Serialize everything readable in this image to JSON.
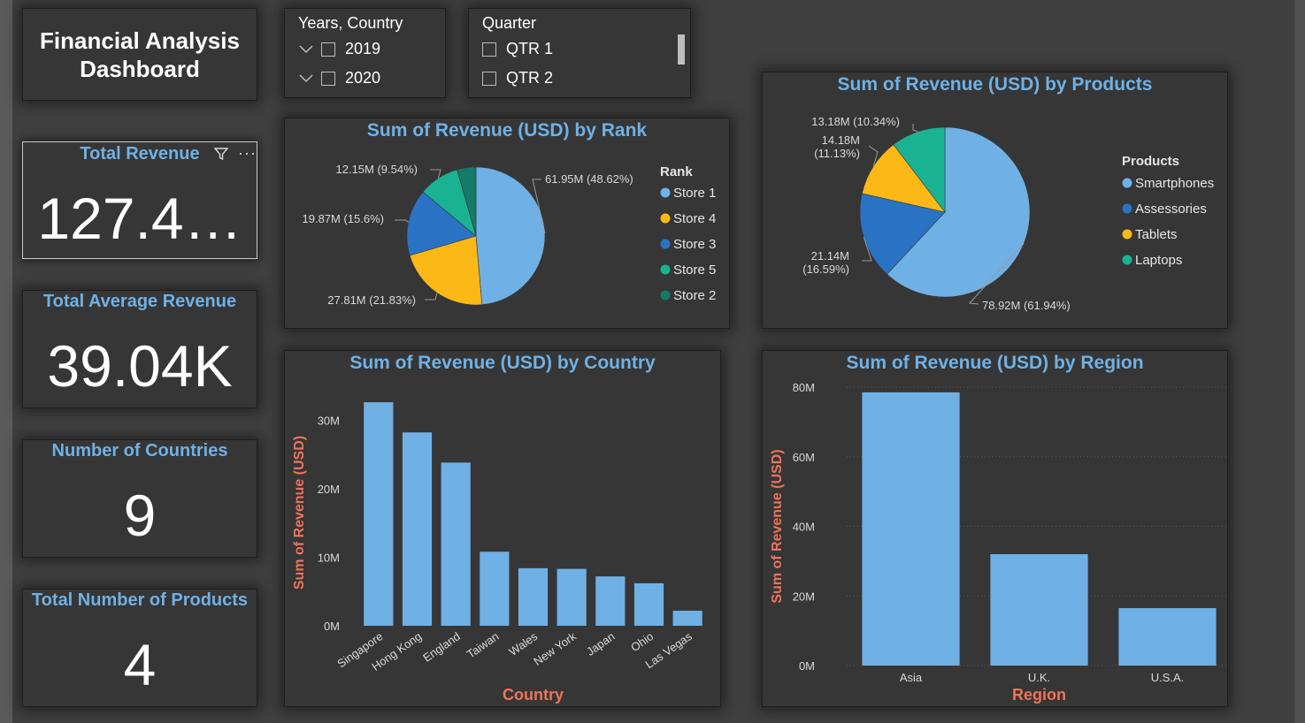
{
  "dashboard": {
    "title": "Financial Analysis Dashboard"
  },
  "colors": {
    "accent": "#6fb1e5",
    "axis_title": "#f0735a",
    "background": "#3f3f3f",
    "panel": "#363636"
  },
  "slicers": {
    "years": {
      "title": "Years, Country",
      "items": [
        {
          "label": "2019"
        },
        {
          "label": "2020"
        }
      ]
    },
    "quarter": {
      "title": "Quarter",
      "items": [
        {
          "label": "QTR 1"
        },
        {
          "label": "QTR 2"
        }
      ]
    }
  },
  "kpis": [
    {
      "label": "Total Revenue",
      "value": "127.4…"
    },
    {
      "label": "Total Average Revenue",
      "value": "39.04K"
    },
    {
      "label": "Number of Countries",
      "value": "9"
    },
    {
      "label": "Total Number of Products",
      "value": "4"
    }
  ],
  "kpi_icons": [
    "filter-icon",
    "more-options-icon"
  ],
  "chart_data": [
    {
      "type": "pie",
      "title": "Sum of Revenue (USD) by Rank",
      "legend_title": "Rank",
      "legend_position": "right",
      "slices": [
        {
          "label": "Store 1",
          "value": 61.95,
          "percent": 48.62,
          "data_label": "61.95M (48.62%)",
          "color": "#6fb1e5"
        },
        {
          "label": "Store 4",
          "value": 27.81,
          "percent": 21.83,
          "data_label": "27.81M (21.83%)",
          "color": "#fbb817"
        },
        {
          "label": "Store 3",
          "value": 19.87,
          "percent": 15.6,
          "data_label": "19.87M (15.6%)",
          "color": "#2a73c4"
        },
        {
          "label": "Store 5",
          "value": 12.15,
          "percent": 9.54,
          "data_label": "12.15M (9.54%)",
          "color": "#19b394"
        },
        {
          "label": "Store 2",
          "value": 5.64,
          "percent": 4.41,
          "data_label": "",
          "color": "#157a68"
        }
      ]
    },
    {
      "type": "pie",
      "title": "Sum of Revenue (USD) by Products",
      "legend_title": "Products",
      "legend_position": "right",
      "slices": [
        {
          "label": "Smartphones",
          "value": 78.92,
          "percent": 61.94,
          "data_label": "78.92M (61.94%)",
          "color": "#6fb1e5"
        },
        {
          "label": "Assessories",
          "value": 21.14,
          "percent": 16.59,
          "data_label": "21.14M\n(16.59%)",
          "color": "#2a73c4"
        },
        {
          "label": "Tablets",
          "value": 14.18,
          "percent": 11.13,
          "data_label": "14.18M\n(11.13%)",
          "color": "#fbb817"
        },
        {
          "label": "Laptops",
          "value": 13.18,
          "percent": 10.34,
          "data_label": "13.18M (10.34%)",
          "color": "#19b394"
        }
      ]
    },
    {
      "type": "bar",
      "title": "Sum of Revenue (USD) by Country",
      "xlabel": "Country",
      "ylabel": "Sum of Revenue (USD)",
      "ylim": [
        0,
        33
      ],
      "yticks": [
        {
          "value": 0,
          "label": "0M"
        },
        {
          "value": 10,
          "label": "10M"
        },
        {
          "value": 20,
          "label": "20M"
        },
        {
          "value": 30,
          "label": "30M"
        }
      ],
      "grid": false,
      "categories": [
        "Singapore",
        "Hong Kong",
        "England",
        "Taiwan",
        "Wales",
        "New York",
        "Japan",
        "Ohio",
        "Las Vegas"
      ],
      "values": [
        32.6,
        28.2,
        23.8,
        10.8,
        8.4,
        8.3,
        7.2,
        6.2,
        2.2
      ]
    },
    {
      "type": "bar",
      "title": "Sum of Revenue (USD) by Region",
      "xlabel": "Region",
      "ylabel": "Sum of Revenue (USD)",
      "ylim": [
        0,
        80
      ],
      "yticks": [
        {
          "value": 0,
          "label": "0M"
        },
        {
          "value": 20,
          "label": "20M"
        },
        {
          "value": 40,
          "label": "40M"
        },
        {
          "value": 60,
          "label": "60M"
        },
        {
          "value": 80,
          "label": "80M"
        }
      ],
      "grid": true,
      "categories": [
        "Asia",
        "U.K.",
        "U.S.A."
      ],
      "values": [
        78.5,
        32,
        16.5
      ]
    }
  ]
}
